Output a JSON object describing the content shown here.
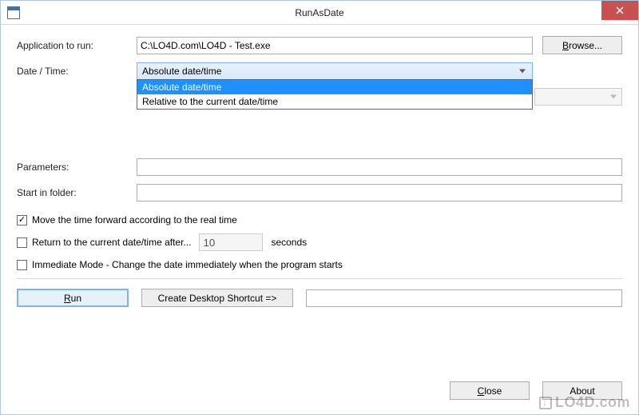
{
  "window": {
    "title": "RunAsDate",
    "close_icon": "close"
  },
  "labels": {
    "app_to_run": "Application to run:",
    "date_time": "Date / Time:",
    "parameters": "Parameters:",
    "start_in": "Start in folder:"
  },
  "fields": {
    "app_path": "C:\\LO4D.com\\LO4D - Test.exe",
    "parameters": "",
    "start_in": "",
    "seconds_value": "10",
    "shortcut_name": ""
  },
  "combo": {
    "selected": "Absolute date/time",
    "options": [
      "Absolute date/time",
      "Relative to the current date/time"
    ]
  },
  "buttons": {
    "browse": "Browse...",
    "run": "Run",
    "create_shortcut": "Create Desktop Shortcut =>",
    "close": "Close",
    "about": "About"
  },
  "checkboxes": {
    "move_forward": {
      "checked": true,
      "label": "Move the time forward according to the real time"
    },
    "return_after": {
      "checked": false,
      "label": "Return to the current date/time after...",
      "unit": "seconds"
    },
    "immediate": {
      "checked": false,
      "label": "Immediate Mode - Change the date immediately when the program starts"
    }
  },
  "watermark": "LO4D.com"
}
